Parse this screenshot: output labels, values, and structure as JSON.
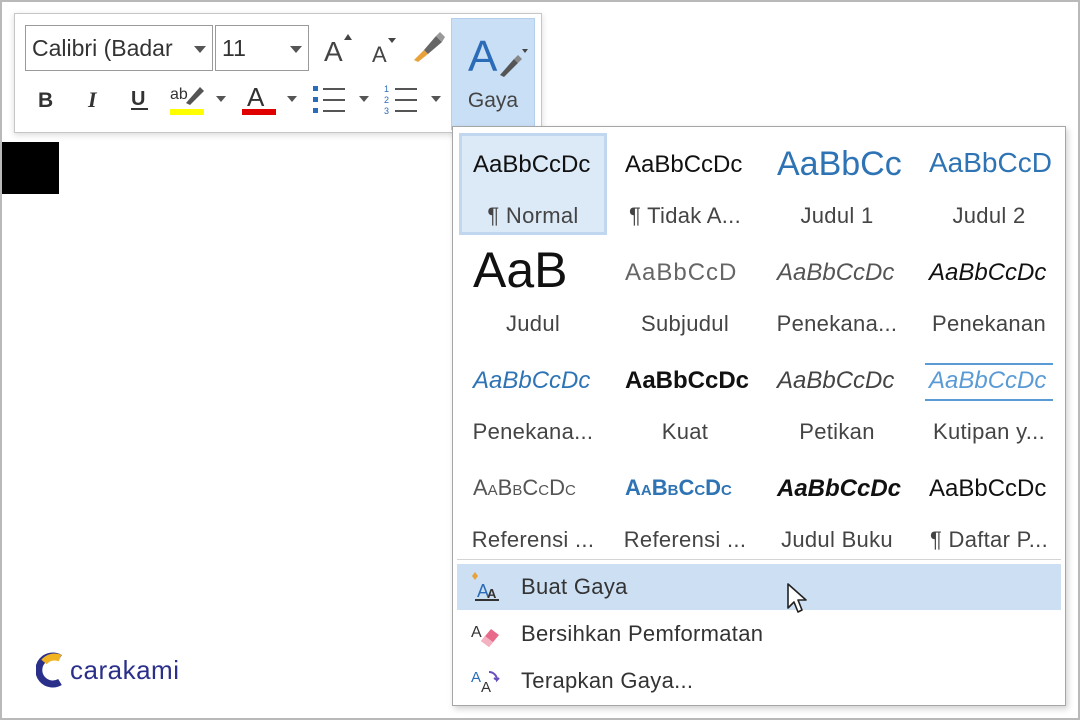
{
  "toolbar": {
    "font_name": "Calibri (Badar",
    "font_size": "11",
    "styles_label": "Gaya",
    "highlight_color": "#ffff00",
    "font_color": "#e00000"
  },
  "gallery": {
    "tiles": [
      {
        "sample": "AaBbCcDc",
        "name": "¶ Normal"
      },
      {
        "sample": "AaBbCcDc",
        "name": "¶ Tidak A..."
      },
      {
        "sample": "AaBbCc",
        "name": "Judul 1"
      },
      {
        "sample": "AaBbCcD",
        "name": "Judul 2"
      },
      {
        "sample": "AaB",
        "name": "Judul"
      },
      {
        "sample": "AaBbCcD",
        "name": "Subjudul"
      },
      {
        "sample": "AaBbCcDc",
        "name": "Penekana..."
      },
      {
        "sample": "AaBbCcDc",
        "name": "Penekanan"
      },
      {
        "sample": "AaBbCcDc",
        "name": "Penekana..."
      },
      {
        "sample": "AaBbCcDc",
        "name": "Kuat"
      },
      {
        "sample": "AaBbCcDc",
        "name": "Petikan"
      },
      {
        "sample": "AaBbCcDc",
        "name": "Kutipan y..."
      },
      {
        "sample": "AaBbCcDc",
        "name": "Referensi ..."
      },
      {
        "sample": "AaBbCcDc",
        "name": "Referensi ..."
      },
      {
        "sample": "AaBbCcDc",
        "name": "Judul Buku"
      },
      {
        "sample": "AaBbCcDc",
        "name": "¶ Daftar P..."
      }
    ]
  },
  "menu": {
    "create_style": "Buat Gaya",
    "clear_formatting": "Bersihkan Pemformatan",
    "apply_styles": "Terapkan Gaya..."
  },
  "watermark": {
    "text": "carakami"
  }
}
